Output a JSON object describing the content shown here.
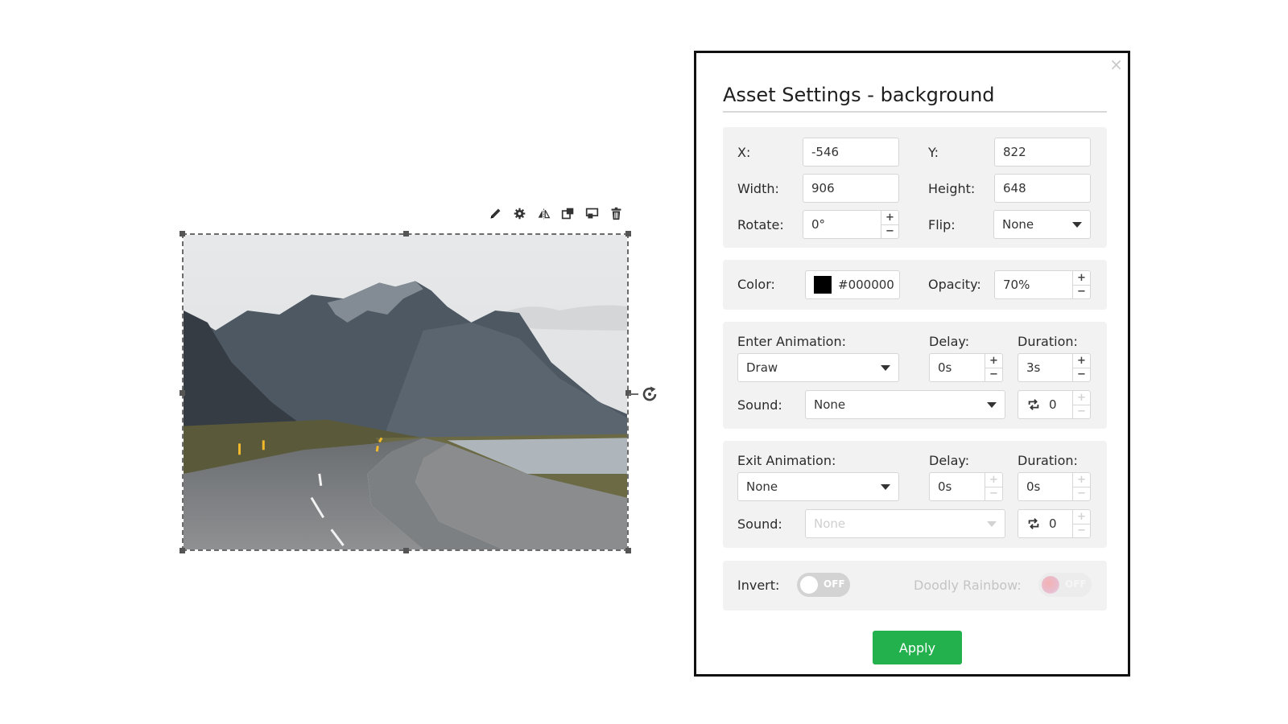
{
  "canvas": {
    "toolbar_icons": [
      "pencil-icon",
      "gear-icon",
      "flip-icon",
      "bring-front-icon",
      "send-back-icon",
      "trash-icon"
    ],
    "image_alt": "Mountain road landscape"
  },
  "dialog": {
    "title": "Asset Settings - background",
    "close_symbol": "×",
    "position": {
      "x_label": "X:",
      "x_value": "-546",
      "y_label": "Y:",
      "y_value": "822",
      "width_label": "Width:",
      "width_value": "906",
      "height_label": "Height:",
      "height_value": "648",
      "rotate_label": "Rotate:",
      "rotate_value": "0°",
      "flip_label": "Flip:",
      "flip_value": "None"
    },
    "appearance": {
      "color_label": "Color:",
      "color_value": "#000000",
      "color_swatch": "#000000",
      "opacity_label": "Opacity:",
      "opacity_value": "70%"
    },
    "enter": {
      "animation_label": "Enter Animation:",
      "animation_value": "Draw",
      "delay_label": "Delay:",
      "delay_value": "0s",
      "duration_label": "Duration:",
      "duration_value": "3s",
      "sound_label": "Sound:",
      "sound_value": "None",
      "loop_value": "0"
    },
    "exit": {
      "animation_label": "Exit Animation:",
      "animation_value": "None",
      "delay_label": "Delay:",
      "delay_value": "0s",
      "duration_label": "Duration:",
      "duration_value": "0s",
      "sound_label": "Sound:",
      "sound_value": "None",
      "loop_value": "0"
    },
    "effects": {
      "invert_label": "Invert:",
      "invert_state": "OFF",
      "rainbow_label": "Doodly Rainbow:",
      "rainbow_state": "OFF"
    },
    "apply_label": "Apply"
  },
  "colors": {
    "apply": "#23b14d",
    "section_bg": "#f2f2f2"
  }
}
